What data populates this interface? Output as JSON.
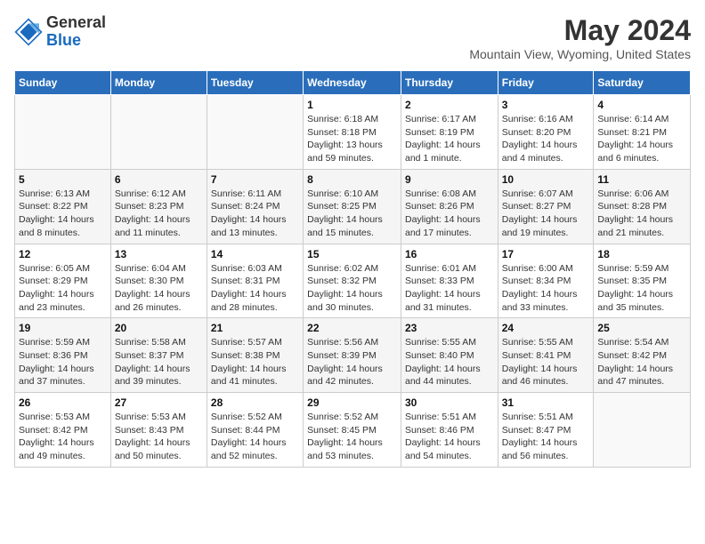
{
  "logo": {
    "general": "General",
    "blue": "Blue"
  },
  "title": "May 2024",
  "subtitle": "Mountain View, Wyoming, United States",
  "days_of_week": [
    "Sunday",
    "Monday",
    "Tuesday",
    "Wednesday",
    "Thursday",
    "Friday",
    "Saturday"
  ],
  "weeks": [
    [
      {
        "day": "",
        "info": ""
      },
      {
        "day": "",
        "info": ""
      },
      {
        "day": "",
        "info": ""
      },
      {
        "day": "1",
        "info": "Sunrise: 6:18 AM\nSunset: 8:18 PM\nDaylight: 13 hours\nand 59 minutes."
      },
      {
        "day": "2",
        "info": "Sunrise: 6:17 AM\nSunset: 8:19 PM\nDaylight: 14 hours\nand 1 minute."
      },
      {
        "day": "3",
        "info": "Sunrise: 6:16 AM\nSunset: 8:20 PM\nDaylight: 14 hours\nand 4 minutes."
      },
      {
        "day": "4",
        "info": "Sunrise: 6:14 AM\nSunset: 8:21 PM\nDaylight: 14 hours\nand 6 minutes."
      }
    ],
    [
      {
        "day": "5",
        "info": "Sunrise: 6:13 AM\nSunset: 8:22 PM\nDaylight: 14 hours\nand 8 minutes."
      },
      {
        "day": "6",
        "info": "Sunrise: 6:12 AM\nSunset: 8:23 PM\nDaylight: 14 hours\nand 11 minutes."
      },
      {
        "day": "7",
        "info": "Sunrise: 6:11 AM\nSunset: 8:24 PM\nDaylight: 14 hours\nand 13 minutes."
      },
      {
        "day": "8",
        "info": "Sunrise: 6:10 AM\nSunset: 8:25 PM\nDaylight: 14 hours\nand 15 minutes."
      },
      {
        "day": "9",
        "info": "Sunrise: 6:08 AM\nSunset: 8:26 PM\nDaylight: 14 hours\nand 17 minutes."
      },
      {
        "day": "10",
        "info": "Sunrise: 6:07 AM\nSunset: 8:27 PM\nDaylight: 14 hours\nand 19 minutes."
      },
      {
        "day": "11",
        "info": "Sunrise: 6:06 AM\nSunset: 8:28 PM\nDaylight: 14 hours\nand 21 minutes."
      }
    ],
    [
      {
        "day": "12",
        "info": "Sunrise: 6:05 AM\nSunset: 8:29 PM\nDaylight: 14 hours\nand 23 minutes."
      },
      {
        "day": "13",
        "info": "Sunrise: 6:04 AM\nSunset: 8:30 PM\nDaylight: 14 hours\nand 26 minutes."
      },
      {
        "day": "14",
        "info": "Sunrise: 6:03 AM\nSunset: 8:31 PM\nDaylight: 14 hours\nand 28 minutes."
      },
      {
        "day": "15",
        "info": "Sunrise: 6:02 AM\nSunset: 8:32 PM\nDaylight: 14 hours\nand 30 minutes."
      },
      {
        "day": "16",
        "info": "Sunrise: 6:01 AM\nSunset: 8:33 PM\nDaylight: 14 hours\nand 31 minutes."
      },
      {
        "day": "17",
        "info": "Sunrise: 6:00 AM\nSunset: 8:34 PM\nDaylight: 14 hours\nand 33 minutes."
      },
      {
        "day": "18",
        "info": "Sunrise: 5:59 AM\nSunset: 8:35 PM\nDaylight: 14 hours\nand 35 minutes."
      }
    ],
    [
      {
        "day": "19",
        "info": "Sunrise: 5:59 AM\nSunset: 8:36 PM\nDaylight: 14 hours\nand 37 minutes."
      },
      {
        "day": "20",
        "info": "Sunrise: 5:58 AM\nSunset: 8:37 PM\nDaylight: 14 hours\nand 39 minutes."
      },
      {
        "day": "21",
        "info": "Sunrise: 5:57 AM\nSunset: 8:38 PM\nDaylight: 14 hours\nand 41 minutes."
      },
      {
        "day": "22",
        "info": "Sunrise: 5:56 AM\nSunset: 8:39 PM\nDaylight: 14 hours\nand 42 minutes."
      },
      {
        "day": "23",
        "info": "Sunrise: 5:55 AM\nSunset: 8:40 PM\nDaylight: 14 hours\nand 44 minutes."
      },
      {
        "day": "24",
        "info": "Sunrise: 5:55 AM\nSunset: 8:41 PM\nDaylight: 14 hours\nand 46 minutes."
      },
      {
        "day": "25",
        "info": "Sunrise: 5:54 AM\nSunset: 8:42 PM\nDaylight: 14 hours\nand 47 minutes."
      }
    ],
    [
      {
        "day": "26",
        "info": "Sunrise: 5:53 AM\nSunset: 8:42 PM\nDaylight: 14 hours\nand 49 minutes."
      },
      {
        "day": "27",
        "info": "Sunrise: 5:53 AM\nSunset: 8:43 PM\nDaylight: 14 hours\nand 50 minutes."
      },
      {
        "day": "28",
        "info": "Sunrise: 5:52 AM\nSunset: 8:44 PM\nDaylight: 14 hours\nand 52 minutes."
      },
      {
        "day": "29",
        "info": "Sunrise: 5:52 AM\nSunset: 8:45 PM\nDaylight: 14 hours\nand 53 minutes."
      },
      {
        "day": "30",
        "info": "Sunrise: 5:51 AM\nSunset: 8:46 PM\nDaylight: 14 hours\nand 54 minutes."
      },
      {
        "day": "31",
        "info": "Sunrise: 5:51 AM\nSunset: 8:47 PM\nDaylight: 14 hours\nand 56 minutes."
      },
      {
        "day": "",
        "info": ""
      }
    ]
  ]
}
